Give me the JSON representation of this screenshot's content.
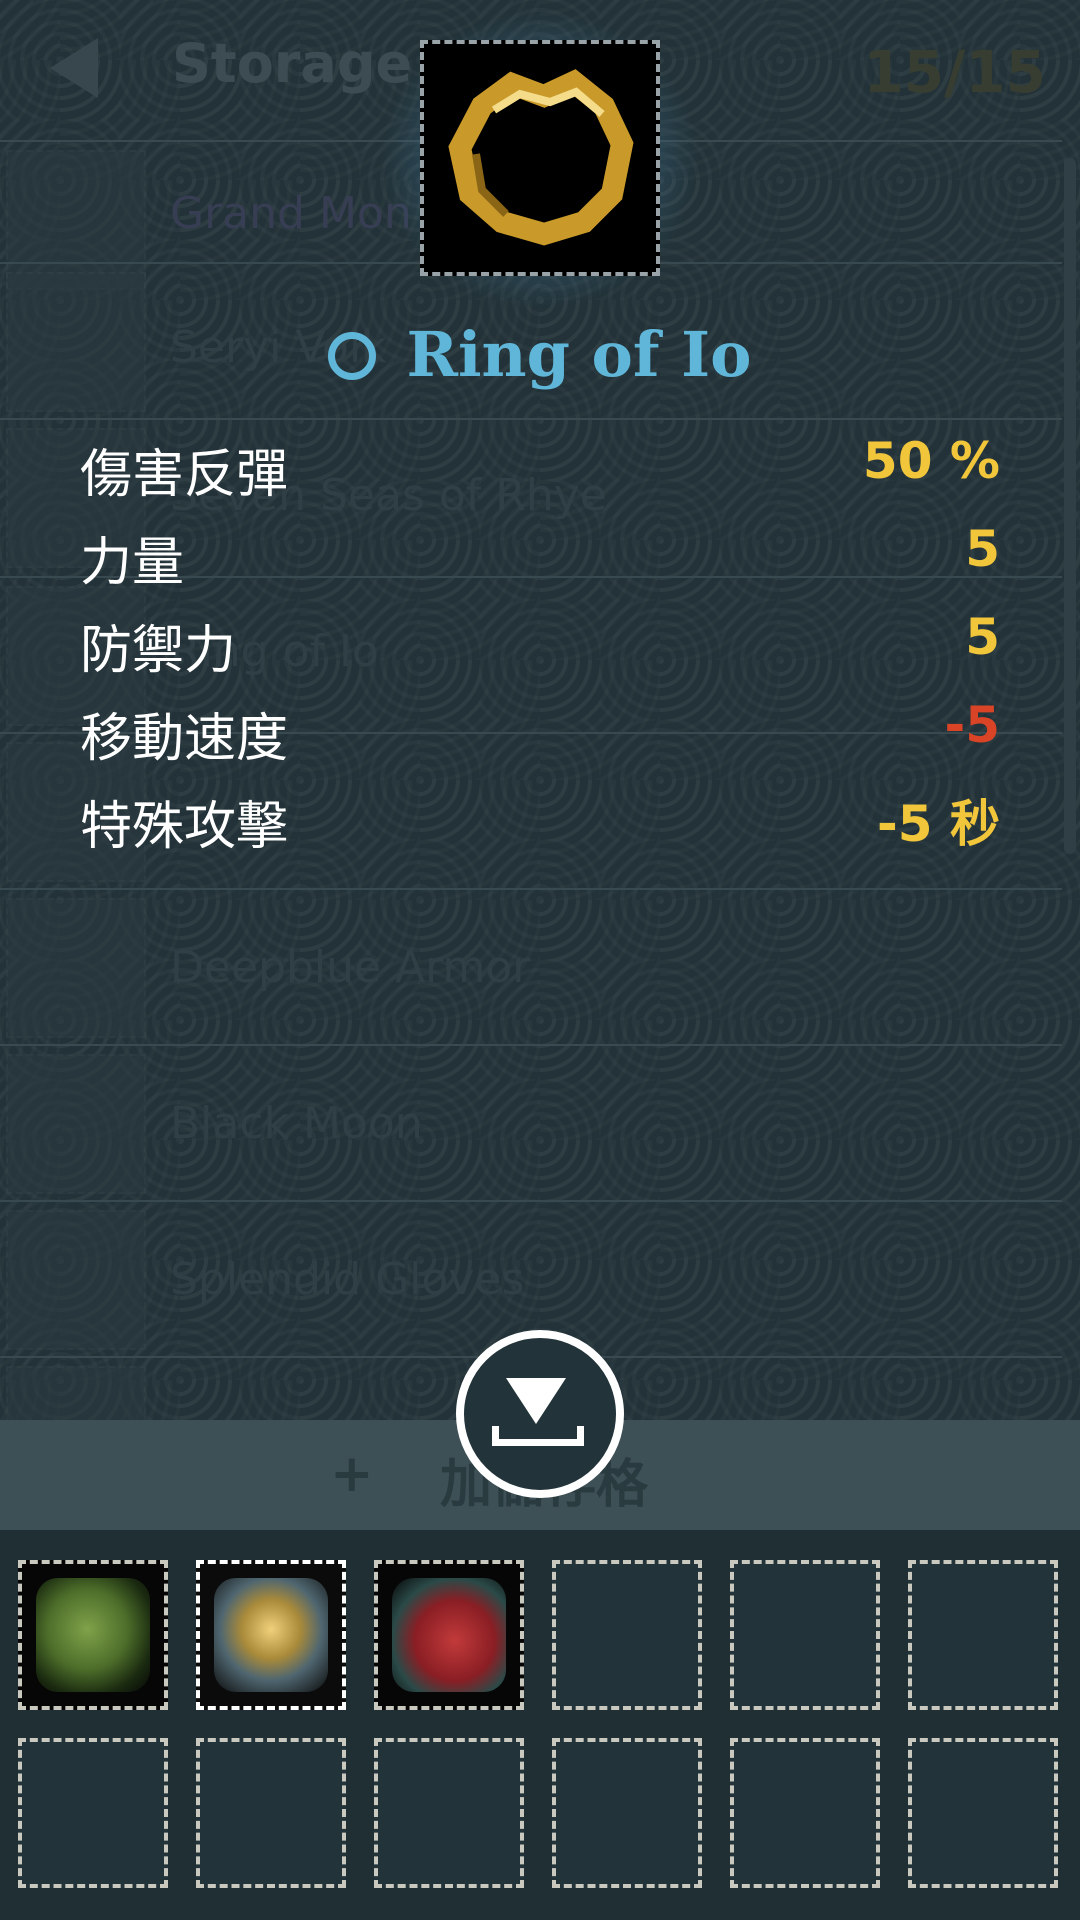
{
  "header": {
    "title": "Storage",
    "count": "15/15"
  },
  "list": {
    "items": [
      {
        "name": "Grand Mon",
        "tail": "n"
      },
      {
        "name": "Seryi Volk",
        "tail": ""
      },
      {
        "name": "Seven Seas of Rhye",
        "tail": ""
      },
      {
        "name": "Ring of Io",
        "tail": ""
      },
      {
        "name": "",
        "tail": ""
      },
      {
        "name": "Deepblue Armor",
        "tail": ""
      },
      {
        "name": "Black Moon",
        "tail": ""
      },
      {
        "name": "Splendid Gloves",
        "tail": ""
      }
    ]
  },
  "item": {
    "name": "Ring of Io",
    "icon": "ring-icon",
    "stats": [
      {
        "label": "傷害反彈",
        "value": "50 %"
      },
      {
        "label": "力量",
        "value": "5"
      },
      {
        "label": "防禦力",
        "value": "5"
      },
      {
        "label": "移動速度",
        "value": "-5"
      },
      {
        "label": "特殊攻擊",
        "value": "-5 秒"
      }
    ]
  },
  "colors": {
    "positive": "#f1c63a",
    "negative": "#d94326",
    "item_name": "#5fb6d8"
  },
  "footer": {
    "expand_plus": "+",
    "expand_label": "加儲存格",
    "download_icon": "download-icon"
  },
  "slots": [
    {
      "content": "green-glove-icon"
    },
    {
      "content": "gold-gauntlet-icon"
    },
    {
      "content": "red-armor-icon"
    },
    {
      "content": ""
    },
    {
      "content": ""
    },
    {
      "content": ""
    },
    {
      "content": ""
    },
    {
      "content": ""
    },
    {
      "content": ""
    },
    {
      "content": ""
    },
    {
      "content": ""
    },
    {
      "content": ""
    }
  ]
}
